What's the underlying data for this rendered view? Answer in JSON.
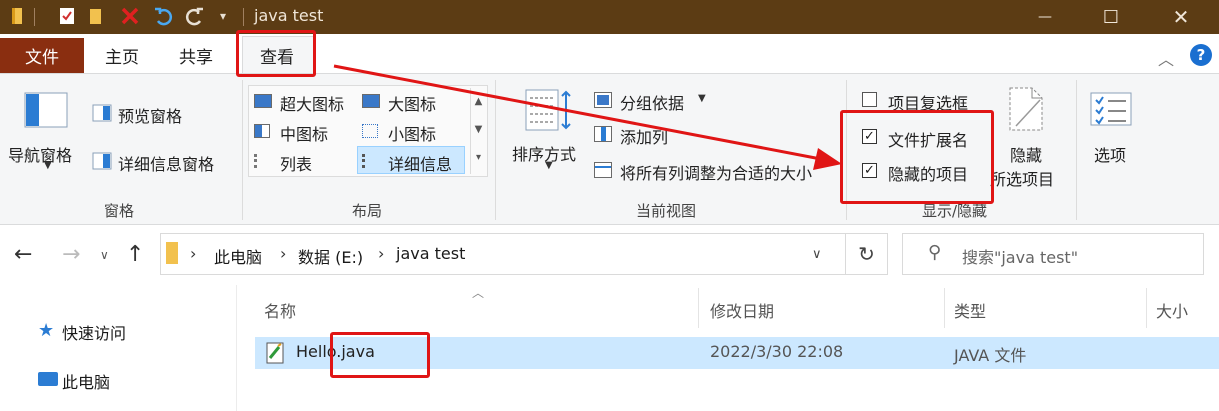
{
  "window": {
    "title": "java test",
    "minimize_glyph": "—",
    "maximize_glyph": "☐",
    "close_glyph": "✕"
  },
  "ribbon_tabs": {
    "file": "文件",
    "home": "主页",
    "share": "共享",
    "view": "查看"
  },
  "panes": {
    "nav_pane": "导航窗格",
    "preview_pane": "预览窗格",
    "details_pane": "详细信息窗格",
    "group_label": "窗格"
  },
  "layout": {
    "extra_large_icons": "超大图标",
    "large_icons": "大图标",
    "medium_icons": "中图标",
    "small_icons": "小图标",
    "list": "列表",
    "details": "详细信息",
    "group_label": "布局"
  },
  "current_view": {
    "sort_by": "排序方式",
    "group_by": "分组依据",
    "add_columns": "添加列",
    "size_all_columns": "将所有列调整为合适的大小",
    "group_label": "当前视图"
  },
  "show_hide": {
    "item_check_boxes": "项目复选框",
    "item_check_boxes_checked": false,
    "file_name_extensions": "文件扩展名",
    "file_name_extensions_checked": true,
    "hidden_items": "隐藏的项目",
    "hidden_items_checked": true,
    "hide_selected_line1": "隐藏",
    "hide_selected_line2": "所选项目",
    "group_label": "显示/隐藏"
  },
  "options": {
    "label": "选项"
  },
  "address": {
    "crumbs": [
      "此电脑",
      "数据 (E:)",
      "java test"
    ],
    "search_placeholder": "搜索\"java test\""
  },
  "nav": {
    "quick_access": "快速访问",
    "this_pc": "此电脑"
  },
  "columns": {
    "name": "名称",
    "date_modified": "修改日期",
    "type": "类型",
    "size": "大小"
  },
  "files": [
    {
      "name": "Hello.java",
      "date_modified": "2022/3/30 22:08",
      "type": "JAVA 文件"
    }
  ],
  "colors": {
    "titlebar": "#5c3c14",
    "file_tab": "#8a2e10",
    "selection": "#cce8ff",
    "annotation": "#e01515"
  }
}
